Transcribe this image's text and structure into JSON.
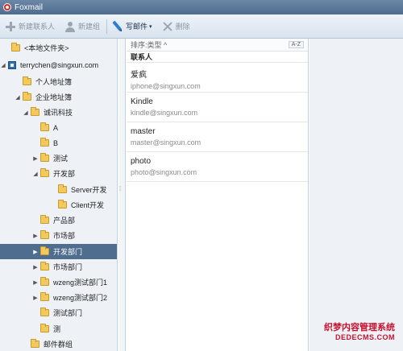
{
  "window": {
    "title": "Foxmail"
  },
  "toolbar": {
    "new_contact": "新建联系人",
    "new_group": "新建组",
    "compose": "写邮件",
    "compose_caret": "▾",
    "delete": "删除"
  },
  "sidebar": {
    "items": [
      {
        "label": "<本地文件夹>",
        "arrow": ""
      },
      {
        "label": "terrychen@singxun.com",
        "arrow": "◢"
      },
      {
        "label": "个人地址簿",
        "arrow": ""
      },
      {
        "label": "企业地址簿",
        "arrow": "◢"
      },
      {
        "label": "诚讯科技",
        "arrow": "◢"
      },
      {
        "label": "A",
        "arrow": ""
      },
      {
        "label": "B",
        "arrow": ""
      },
      {
        "label": "测试",
        "arrow": "▶"
      },
      {
        "label": "开发部",
        "arrow": "◢"
      },
      {
        "label": "Server开发",
        "arrow": ""
      },
      {
        "label": "Client开发",
        "arrow": ""
      },
      {
        "label": "产品部",
        "arrow": ""
      },
      {
        "label": "市场部",
        "arrow": "▶"
      },
      {
        "label": "开发部门",
        "arrow": "▶"
      },
      {
        "label": "市场部门",
        "arrow": "▶"
      },
      {
        "label": "wzeng测试部门1",
        "arrow": "▶"
      },
      {
        "label": "wzeng测试部门2",
        "arrow": "▶"
      },
      {
        "label": "测试部门",
        "arrow": ""
      },
      {
        "label": "测",
        "arrow": ""
      },
      {
        "label": "邮件群组",
        "arrow": ""
      }
    ],
    "selected_index": 13
  },
  "splitter": {
    "grip": "⁞"
  },
  "list": {
    "sort_label": "排序:类型 ^",
    "sort_button": "A-Z",
    "group_header": "联系人",
    "contacts": [
      {
        "name": "爱疯",
        "email": "iphone@singxun.com"
      },
      {
        "name": "Kindle",
        "email": "kindle@singxun.com"
      },
      {
        "name": "master",
        "email": "master@singxun.com"
      },
      {
        "name": "photo",
        "email": "photo@singxun.com"
      }
    ]
  },
  "watermark": {
    "line1": "织梦内容管理系统",
    "line2": "DEDECMS.COM"
  }
}
